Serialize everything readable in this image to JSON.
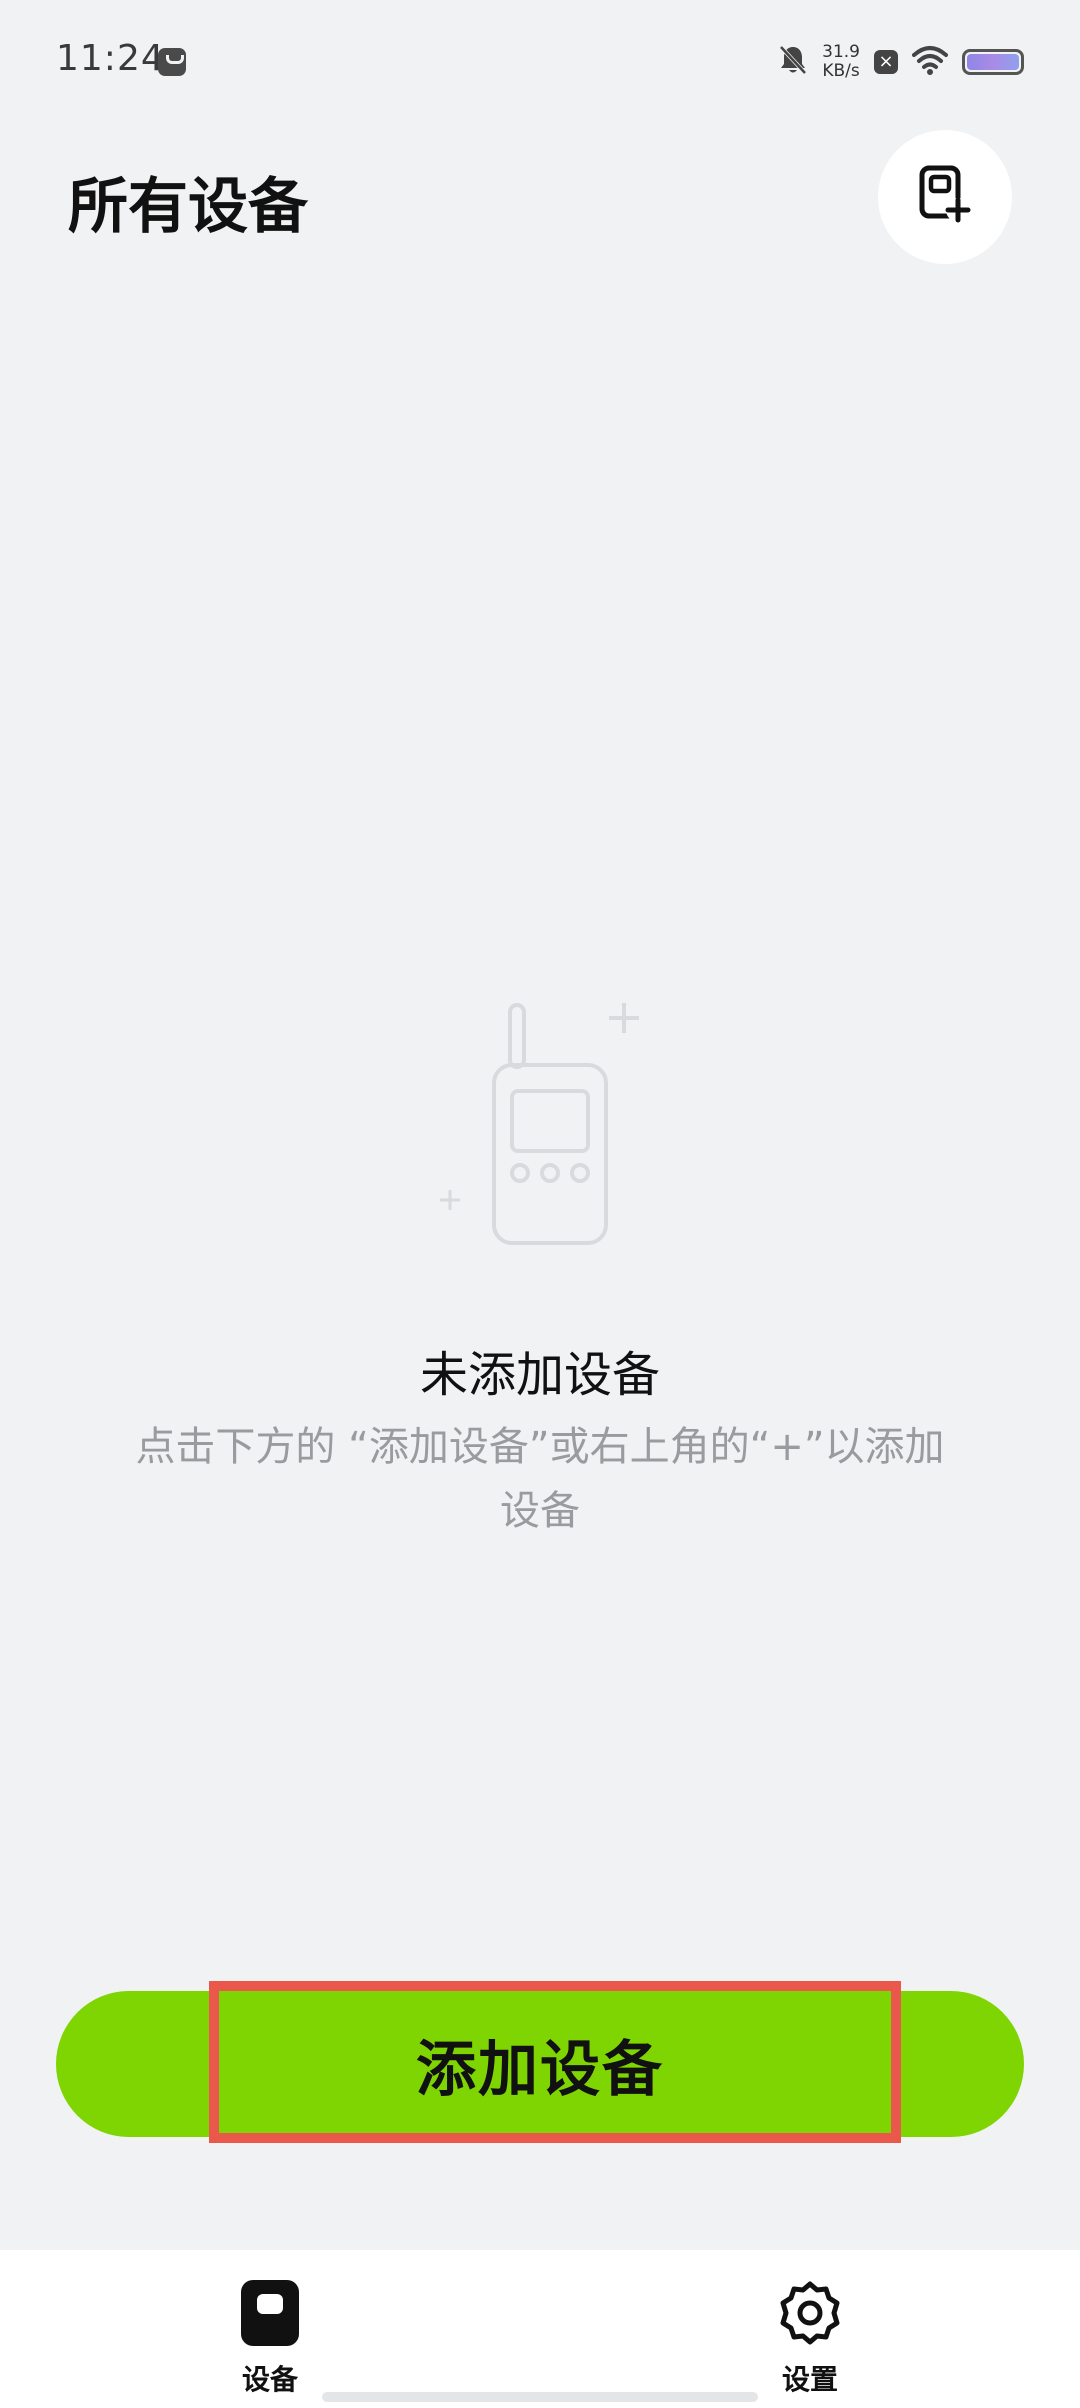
{
  "status_bar": {
    "time": "11:24",
    "net_speed_value": "31.9",
    "net_speed_unit": "KB/s",
    "icons": [
      "notification-app-icon",
      "bell-muted-icon",
      "close-box-icon",
      "wifi-icon",
      "battery-icon"
    ]
  },
  "header": {
    "title": "所有设备",
    "add_button_icon": "add-device-icon"
  },
  "empty_state": {
    "illustration_icon": "walkie-talkie-icon",
    "title": "未添加设备",
    "description": "点击下方的 “添加设备”或右上角的“+”以添加设备"
  },
  "primary_action": {
    "label": "添加设备",
    "color": "#7ED501"
  },
  "bottom_nav": {
    "items": [
      {
        "label": "设备",
        "icon": "device-icon",
        "active": true
      },
      {
        "label": "设置",
        "icon": "settings-gear-icon",
        "active": false
      }
    ]
  },
  "colors": {
    "background": "#F1F2F4",
    "accent": "#7ED501",
    "highlight": "#E9584B"
  }
}
